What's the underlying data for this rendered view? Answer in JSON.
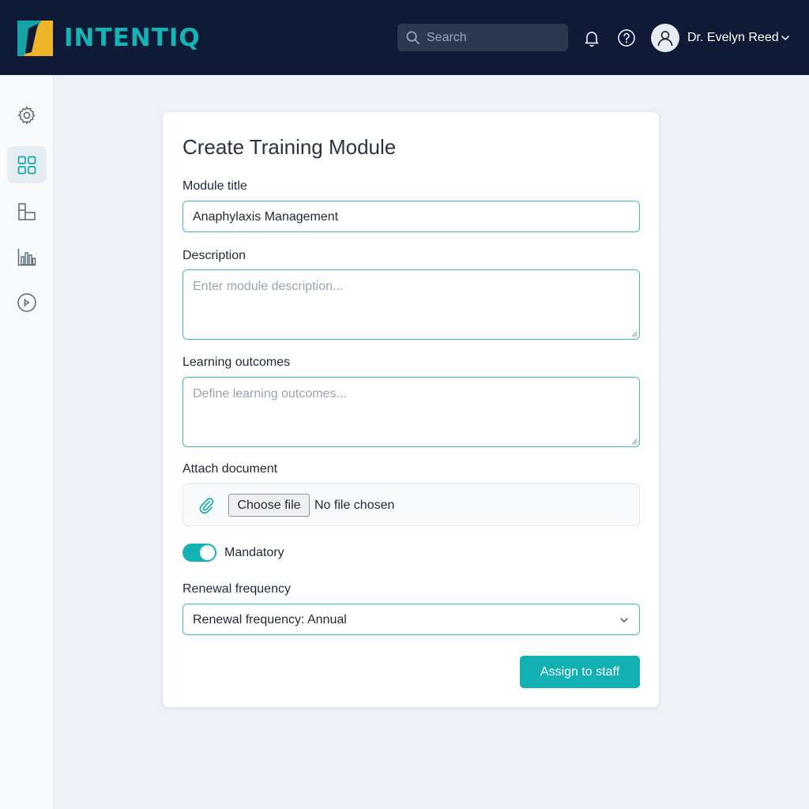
{
  "header": {
    "brand": "INTENTIQ",
    "search_placeholder": "Search",
    "user_name": "Dr. Evelyn Reed",
    "icons": [
      "logo-icon",
      "search-icon",
      "bell-icon",
      "help-icon",
      "avatar-icon",
      "chevron-down-icon"
    ]
  },
  "sidebar": {
    "items": [
      {
        "name": "settings",
        "icon": "gear-icon",
        "active": false
      },
      {
        "name": "dashboard",
        "icon": "grid-icon",
        "active": true
      },
      {
        "name": "structure",
        "icon": "blocks-icon",
        "active": false
      },
      {
        "name": "analytics",
        "icon": "bar-chart-icon",
        "active": false
      },
      {
        "name": "media",
        "icon": "play-circle-icon",
        "active": false
      }
    ]
  },
  "form": {
    "title": "Create Training Module",
    "module_title_label": "Module title",
    "module_title_value": "Anaphylaxis Management",
    "description_label": "Description",
    "description_placeholder": "Enter module description...",
    "outcomes_label": "Learning outcomes",
    "outcomes_placeholder": "Define learning outcomes...",
    "attach_label": "Attach document",
    "choose_file_label": "Choose file",
    "no_file_text": "No file chosen",
    "mandatory_label": "Mandatory",
    "mandatory_on": true,
    "renewal_label": "Renewal frequency",
    "renewal_value": "Renewal frequency: Annual",
    "submit_label": "Assign to staff"
  },
  "colors": {
    "topbar": "#0f1b36",
    "accent": "#13b0b3",
    "logo_yellow": "#f0b429",
    "logo_teal": "#16a3a6"
  }
}
